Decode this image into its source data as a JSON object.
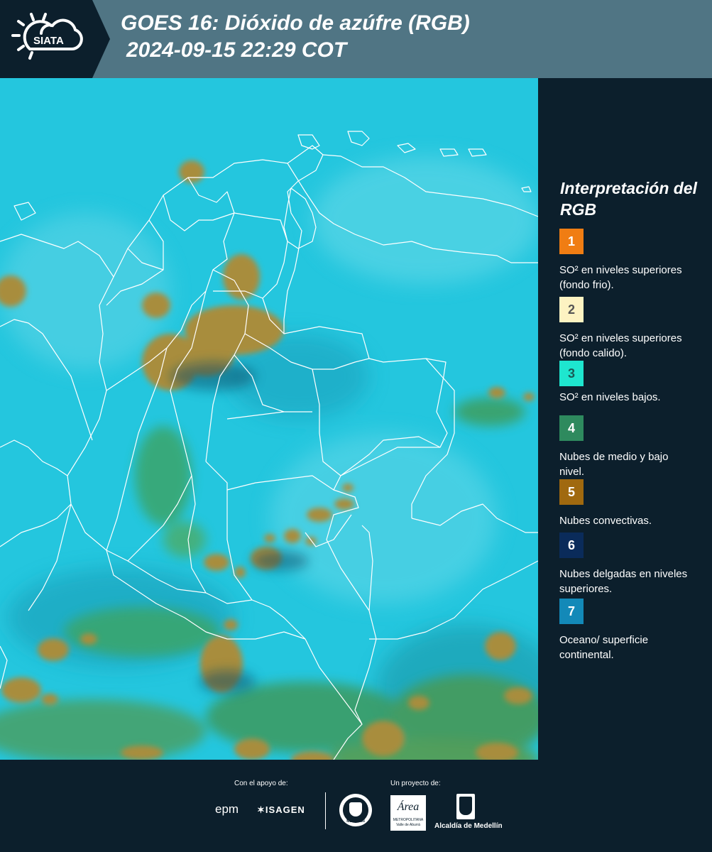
{
  "header": {
    "logo_text": "SIATA",
    "title_line1": "GOES 16: Dióxido de azúfre (RGB)",
    "title_line2": "2024-09-15 22:29 COT"
  },
  "legend": {
    "title": "Interpretación del RGB",
    "items": [
      {
        "number": "1",
        "color": "#f07d13",
        "label": "SO² en niveles superiores (fondo frio)."
      },
      {
        "number": "2",
        "color": "#fdf3c2",
        "label": "SO² en niveles superiores (fondo calido)."
      },
      {
        "number": "3",
        "color": "#1ee6cf",
        "label": "SO² en niveles bajos."
      },
      {
        "number": "4",
        "color": "#2e8a5e",
        "label": "Nubes de medio y bajo nivel."
      },
      {
        "number": "5",
        "color": "#a0690f",
        "label": "Nubes convectivas."
      },
      {
        "number": "6",
        "color": "#0a2b5a",
        "label": "Nubes delgadas en niveles superiores."
      },
      {
        "number": "7",
        "color": "#1389b8",
        "label": "Oceano/ superficie continental."
      }
    ]
  },
  "footer": {
    "support_label": "Con el apoyo de:",
    "project_label": "Un proyecto de:",
    "sponsor1": "epm",
    "sponsor2": "ISAGEN",
    "partner1": "MEDELLÍN",
    "partner2_title": "Área",
    "partner2_sub": "METROPOLITANA",
    "partner2_sub2": "Valle de Aburrá",
    "partner3": "Alcaldía de Medellín"
  },
  "colors": {
    "background": "#0c1f2c",
    "header": "#507584",
    "map_base": "#22c3dd",
    "cloud": "#9e8a3a",
    "green": "#3aa060"
  }
}
